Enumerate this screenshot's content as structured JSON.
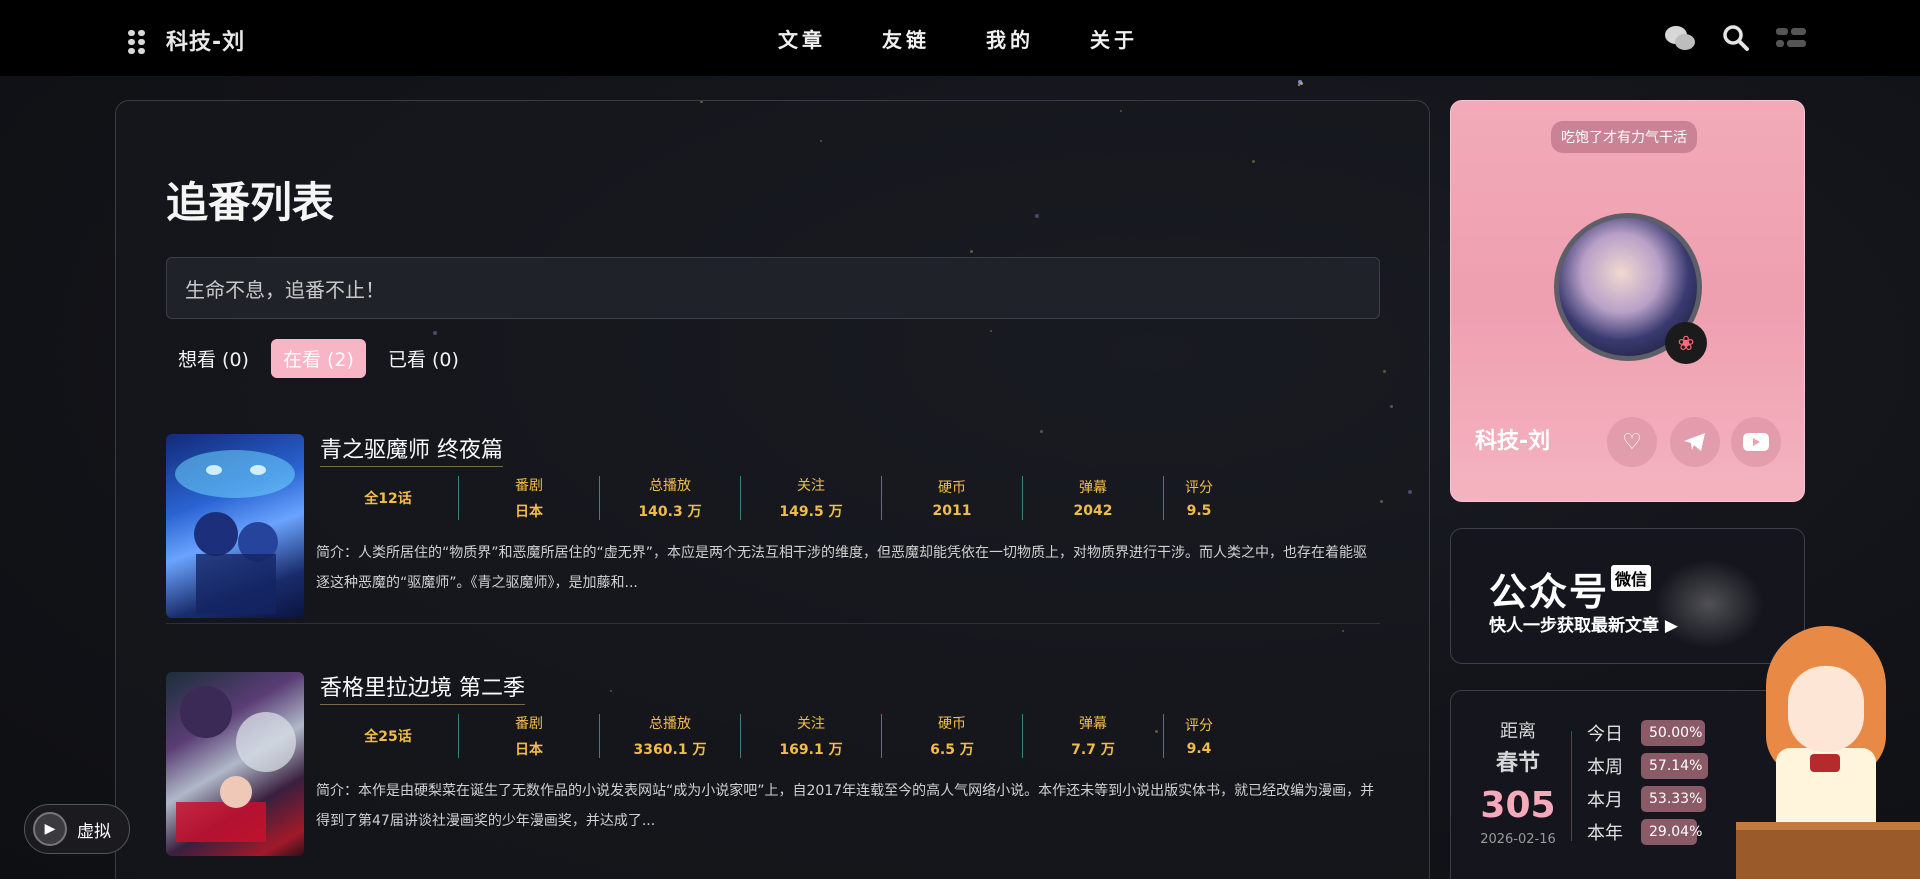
{
  "header": {
    "brand": "科技-刘",
    "nav": [
      "文章",
      "友链",
      "我的",
      "关于"
    ],
    "icons": [
      "wechat-icon",
      "search-icon",
      "menu-icon"
    ]
  },
  "main": {
    "title": "追番列表",
    "search_placeholder": "生命不息，追番不止！",
    "tabs": [
      {
        "label": "想看 (0)"
      },
      {
        "label": "在看 (2)",
        "active": true
      },
      {
        "label": "已看 (0)"
      }
    ],
    "anime": [
      {
        "title": "青之驱魔师 终夜篇",
        "episodes": "全12话",
        "type_label": "番剧",
        "type_value": "日本",
        "plays_label": "总播放",
        "plays_value": "140.3 万",
        "follows_label": "关注",
        "follows_value": "149.5 万",
        "coins_label": "硬币",
        "coins_value": "2011",
        "danmaku_label": "弹幕",
        "danmaku_value": "2042",
        "score_label": "评分",
        "score_value": "9.5",
        "desc": "简介：人类所居住的“物质界”和恶魔所居住的“虚无界”，本应是两个无法互相干涉的维度，但恶魔却能凭依在一切物质上，对物质界进行干涉。而人类之中，也存在着能驱逐这种恶魔的“驱魔师”。《青之驱魔师》，是加藤和..."
      },
      {
        "title": "香格里拉边境 第二季",
        "episodes": "全25话",
        "type_label": "番剧",
        "type_value": "日本",
        "plays_label": "总播放",
        "plays_value": "3360.1 万",
        "follows_label": "关注",
        "follows_value": "169.1 万",
        "coins_label": "硬币",
        "coins_value": "6.5 万",
        "danmaku_label": "弹幕",
        "danmaku_value": "7.7 万",
        "score_label": "评分",
        "score_value": "9.4",
        "desc": "简介：本作是由硬梨菜在诞生了无数作品的小说发表网站“成为小说家吧”上，自2017年连载至今的高人气网络小说。本作还未等到小说出版实体书，就已经改编为漫画，并得到了第47届讲谈社漫画奖的少年漫画奖，并达成了..."
      }
    ]
  },
  "profile": {
    "motto": "吃饱了才有力气干活",
    "name": "科技-刘",
    "social_icons": [
      "heart-icon",
      "telegram-icon",
      "youtube-icon"
    ]
  },
  "wechat": {
    "title": "公众号",
    "tag": "微信",
    "subtitle": "快人一步获取最新文章 ▶"
  },
  "countdown": {
    "label": "距离",
    "event": "春节",
    "days": "305",
    "date": "2026-02-16",
    "rows": [
      {
        "key": "今日",
        "percent": "50.00%",
        "fraction": 0.5
      },
      {
        "key": "本周",
        "percent": "57.14%",
        "fraction": 0.5714
      },
      {
        "key": "本月",
        "percent": "53.33%",
        "fraction": 0.5333
      },
      {
        "key": "本年",
        "percent": "29.04%",
        "fraction": 0.2904
      }
    ]
  },
  "virtual_button": {
    "label": "虚拟"
  },
  "colors": {
    "accent": "#f7b5c5",
    "stat": "#f2bc4b",
    "bg": "#121318"
  }
}
